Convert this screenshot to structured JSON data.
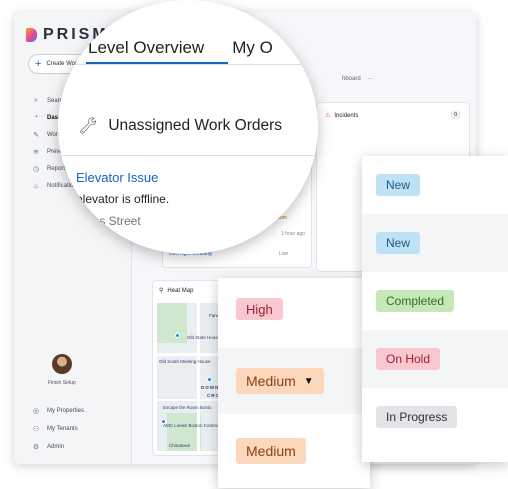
{
  "app": {
    "logo_text": "PRISM",
    "create_label": "Create Work",
    "nav": [
      {
        "label": "Search",
        "icon": "search-icon"
      },
      {
        "label": "Dashb",
        "icon": "dashboard-icon",
        "active": true
      },
      {
        "label": "Work",
        "icon": "work-icon"
      },
      {
        "label": "Preven",
        "icon": "preventive-icon"
      },
      {
        "label": "Reports",
        "icon": "reports-icon"
      },
      {
        "label": "Notification",
        "icon": "bell-icon"
      }
    ],
    "finish_setup": "Finish Setup",
    "bottom_nav": [
      {
        "label": "My Properties",
        "icon": "properties-icon"
      },
      {
        "label": "My Tenants",
        "icon": "tenants-icon"
      },
      {
        "label": "Admin",
        "icon": "admin-icon"
      }
    ]
  },
  "main": {
    "tab_ghost": "hboard",
    "tab_more": "···",
    "cards": {
      "work_orders_mini": [
        {
          "badge": "Medium",
          "time": "1 hour ago"
        },
        {
          "title": "Overnight Cleaning",
          "badge": "Low"
        }
      ],
      "incidents": {
        "title": "Incidents",
        "count": "0"
      },
      "heatmap": {
        "title": "Heat Map",
        "labels": [
          "Faneuil Hall Ma",
          "Old State House",
          "Old South Meeting House",
          "DOWNTOWN",
          "CROSSING",
          "Escape the Room Bosto",
          "AMC Loews Boston Common 19",
          "Chinatown"
        ]
      }
    }
  },
  "magnifier": {
    "tab_active": "Level Overview",
    "tab_other": "My O",
    "section_title": "Unassigned Work Orders",
    "issue_title": "Elevator Issue",
    "issue_desc": "elevator is offline.",
    "issue_address": "gress Street"
  },
  "priority_panel": {
    "items": [
      {
        "label": "High",
        "style": "high"
      },
      {
        "label": "Medium",
        "style": "medium",
        "dropdown": true
      },
      {
        "label": "Medium",
        "style": "medium"
      }
    ]
  },
  "status_panel": {
    "items": [
      {
        "label": "New",
        "style": "new"
      },
      {
        "label": "New",
        "style": "new"
      },
      {
        "label": "Completed",
        "style": "completed"
      },
      {
        "label": "On Hold",
        "style": "hold"
      },
      {
        "label": "In Progress",
        "style": "progress"
      }
    ]
  },
  "colors": {
    "accent": "#1565c0",
    "high": "#f8c7cf",
    "medium": "#fbd7bb",
    "new": "#bfe1f6",
    "completed": "#c5e8b8",
    "in_progress": "#e2e4e8"
  }
}
